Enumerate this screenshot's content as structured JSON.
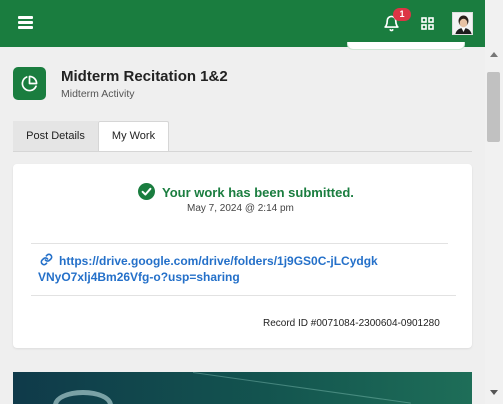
{
  "header": {
    "notification_count": "1",
    "icons": [
      "hamburger-menu-icon",
      "bell-icon",
      "apps-grid-icon",
      "user-avatar"
    ]
  },
  "post": {
    "title": "Midterm Recitation 1&2",
    "subtitle": "Midterm Activity",
    "icon": "pie-chart-icon"
  },
  "tabs": [
    {
      "label": "Post Details",
      "active": false
    },
    {
      "label": "My Work",
      "active": true
    }
  ],
  "submission": {
    "status": "Your work has been submitted.",
    "date": "May 7, 2024 @ 2:14 pm",
    "link": "https://drive.google.com/drive/folders/1j9GS0C-jLCydgkVNyO7xlj4Bm26Vfg-o?usp=sharing",
    "record": "Record ID #0071084-2300604-0901280"
  },
  "colors": {
    "brand": "#1a7d3f",
    "link": "#2470c9",
    "badge": "#dc3545"
  }
}
